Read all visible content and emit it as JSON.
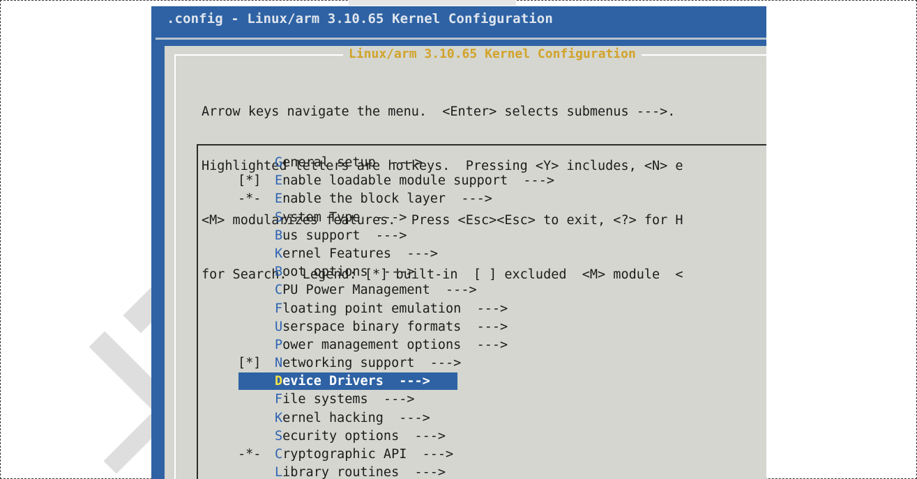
{
  "window": {
    "title": ".config - Linux/arm 3.10.65 Kernel Configuration"
  },
  "dialog": {
    "title": "Linux/arm 3.10.65 Kernel Configuration",
    "help_lines": [
      "Arrow keys navigate the menu.  <Enter> selects submenus --->.",
      "Highlighted letters are hotkeys.  Pressing <Y> includes, <N> e",
      "<M> modularizes features.  Press <Esc><Esc> to exit, <?> for H",
      "for Search.  Legend: [*] built-in  [ ] excluded  <M> module  <"
    ]
  },
  "menu": {
    "selected_index": 12,
    "items": [
      {
        "marker": "",
        "hotkey": "G",
        "rest": "eneral setup  --->"
      },
      {
        "marker": "[*]",
        "hotkey": "E",
        "rest": "nable loadable module support  --->"
      },
      {
        "marker": "-*-",
        "hotkey": "E",
        "rest": "nable the block layer  --->"
      },
      {
        "marker": "",
        "hotkey": "S",
        "rest": "ystem Type  --->"
      },
      {
        "marker": "",
        "hotkey": "B",
        "rest": "us support  --->"
      },
      {
        "marker": "",
        "hotkey": "K",
        "rest": "ernel Features  --->"
      },
      {
        "marker": "",
        "hotkey": "B",
        "rest": "oot options  --->"
      },
      {
        "marker": "",
        "hotkey": "C",
        "rest": "PU Power Management  --->"
      },
      {
        "marker": "",
        "hotkey": "F",
        "rest": "loating point emulation  --->"
      },
      {
        "marker": "",
        "hotkey": "U",
        "rest": "serspace binary formats  --->"
      },
      {
        "marker": "",
        "hotkey": "P",
        "rest": "ower management options  --->"
      },
      {
        "marker": "[*]",
        "hotkey": "N",
        "rest": "etworking support  --->"
      },
      {
        "marker": "",
        "hotkey": "D",
        "rest": "evice Drivers  --->"
      },
      {
        "marker": "",
        "hotkey": "F",
        "rest": "ile systems  --->"
      },
      {
        "marker": "",
        "hotkey": "K",
        "rest": "ernel hacking  --->"
      },
      {
        "marker": "",
        "hotkey": "S",
        "rest": "ecurity options  --->"
      },
      {
        "marker": "-*-",
        "hotkey": "C",
        "rest": "ryptographic API  --->"
      },
      {
        "marker": "",
        "hotkey": "L",
        "rest": "ibrary routines  --->"
      }
    ]
  },
  "colors": {
    "terminal_bg": "#2e62a4",
    "dialog_bg": "#d4d6cf",
    "hotkey": "#2f63b3",
    "selected_hotkey": "#f2e04a",
    "dialog_title": "#d2a32a"
  }
}
